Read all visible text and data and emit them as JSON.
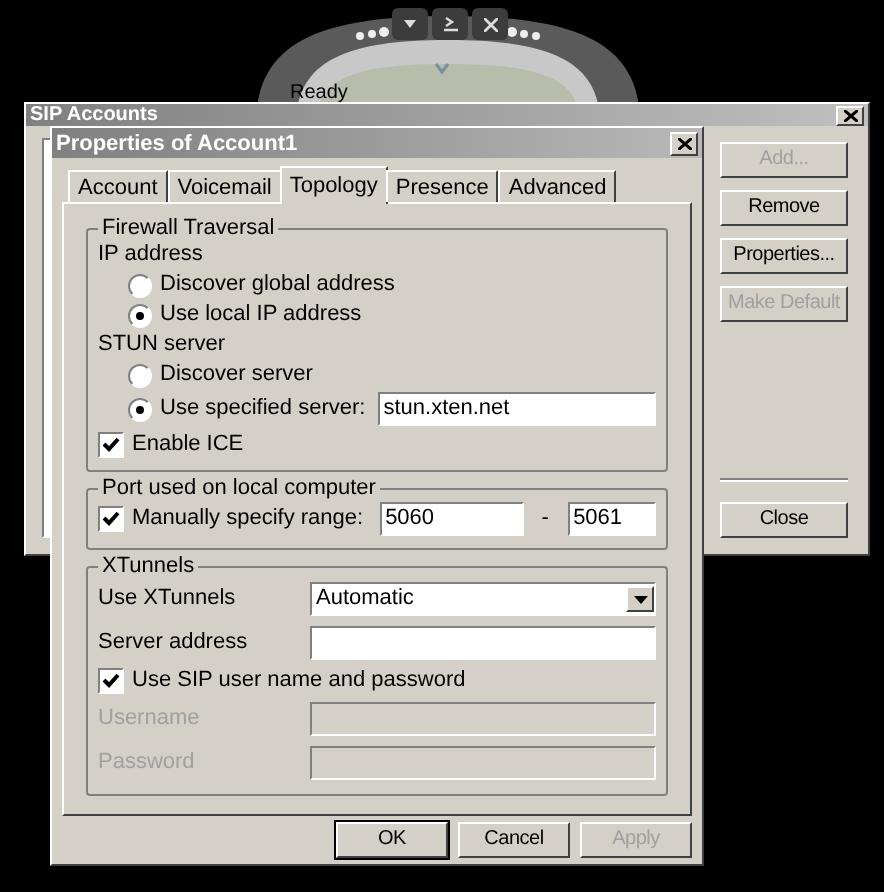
{
  "phone": {
    "status": "Ready"
  },
  "sip_accounts": {
    "title": "SIP Accounts",
    "buttons": [
      {
        "label": "Add...",
        "disabled": true
      },
      {
        "label": "Remove",
        "disabled": false
      },
      {
        "label": "Properties...",
        "disabled": false
      },
      {
        "label": "Make Default",
        "disabled": true
      }
    ],
    "close_button": "Close"
  },
  "properties": {
    "title": "Properties of Account1",
    "tabs": [
      {
        "label": "Account",
        "selected": false
      },
      {
        "label": "Voicemail",
        "selected": false
      },
      {
        "label": "Topology",
        "selected": true
      },
      {
        "label": "Presence",
        "selected": false
      },
      {
        "label": "Advanced",
        "selected": false
      }
    ],
    "firewall_traversal": {
      "title": "Firewall Traversal",
      "ip_address": {
        "label": "IP address",
        "options": [
          {
            "label": "Discover global address",
            "selected": false
          },
          {
            "label": "Use local IP address",
            "selected": true
          }
        ]
      },
      "stun_server": {
        "label": "STUN server",
        "options": [
          {
            "label": "Discover server",
            "selected": false
          },
          {
            "label": "Use specified server:",
            "selected": true,
            "value": "stun.xten.net"
          }
        ]
      },
      "enable_ice": {
        "label": "Enable ICE",
        "checked": true
      }
    },
    "port": {
      "title": "Port used on local computer",
      "manual": {
        "label": "Manually specify range:",
        "checked": true
      },
      "from": "5060",
      "separator": "-",
      "to": "5061"
    },
    "xtunnels": {
      "title": "XTunnels",
      "use_xtunnels": {
        "label": "Use XTunnels",
        "value": "Automatic"
      },
      "server_address": {
        "label": "Server address"
      },
      "use_sip": {
        "label": "Use SIP user name and password",
        "checked": true
      },
      "username": {
        "label": "Username",
        "disabled": true
      },
      "password": {
        "label": "Password",
        "disabled": true
      }
    },
    "buttons": [
      {
        "label": "OK",
        "default": true,
        "disabled": false
      },
      {
        "label": "Cancel",
        "default": false,
        "disabled": false
      },
      {
        "label": "Apply",
        "default": false,
        "disabled": true
      }
    ]
  }
}
